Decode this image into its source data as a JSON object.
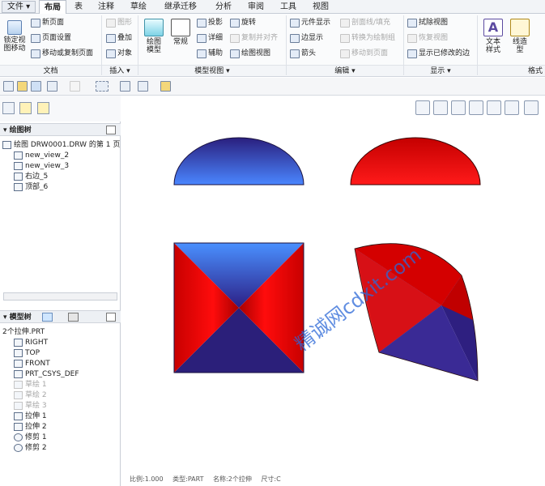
{
  "menu": {
    "file": "文件 ▾",
    "tabs": [
      "布局",
      "表",
      "注释",
      "草绘",
      "继承迁移",
      "分析",
      "审阅",
      "工具",
      "视图"
    ]
  },
  "ribbon": {
    "doc": {
      "lock_view": "锁定视\n图移动",
      "new_page": "新页面",
      "page_setup": "页面设置",
      "move_copy_page": "移动或复制页面",
      "label": "文档"
    },
    "insert": {
      "graphic": "图形",
      "overlay": "叠加",
      "object": "对象",
      "label": "插入 ▾"
    },
    "model_views": {
      "drawing_model": "绘图\n模型",
      "general": "常规",
      "projection": "投影",
      "detail": "详细",
      "auxiliary": "辅助",
      "rotate": "旋转",
      "copy_align": "复制并对齐",
      "drawing_view": "绘图视图",
      "label": "模型视图 ▾"
    },
    "edit": {
      "element_display": "元件显示",
      "edge_display": "边显示",
      "arrow": "箭头",
      "section_fill": "剖面线/填充",
      "convert_draw_group": "转换为绘制组",
      "move_to_page": "移动到页面",
      "label": "编辑 ▾"
    },
    "display": {
      "erase_view": "拭除视图",
      "restore_view": "恢复视图",
      "show_modified_edges": "显示已修改的边",
      "label": "显示 ▾"
    },
    "format": {
      "text_style": "文本\n样式",
      "line_style": "线造\n型",
      "label": "格式"
    }
  },
  "drawing_tree": {
    "title": "绘图树",
    "items": [
      "绘图 DRW0001.DRW 的第 1 页",
      "new_view_2",
      "new_view_3",
      "右边_5",
      "顶部_6"
    ]
  },
  "model_tree": {
    "title": "模型树",
    "root": "2个拉伸.PRT",
    "items": [
      {
        "label": "RIGHT",
        "dim": false
      },
      {
        "label": "TOP",
        "dim": false
      },
      {
        "label": "FRONT",
        "dim": false
      },
      {
        "label": "PRT_CSYS_DEF",
        "dim": false
      },
      {
        "label": "草绘 1",
        "dim": true
      },
      {
        "label": "草绘 2",
        "dim": true
      },
      {
        "label": "草绘 3",
        "dim": true
      },
      {
        "label": "拉伸 1",
        "dim": false
      },
      {
        "label": "拉伸 2",
        "dim": false
      },
      {
        "label": "修剪 1",
        "dim": false
      },
      {
        "label": "修剪 2",
        "dim": false
      }
    ]
  },
  "status": {
    "scale": "比例:1.000",
    "type": "类型:PART",
    "name": "名称:2个拉伸",
    "size": "尺寸:C"
  },
  "watermark": "精诚网cdxit.com",
  "colors": {
    "blue_shade": "#2b1f8a",
    "blue_light": "#3f7de8",
    "red_shade": "#d10d0d",
    "red_dark": "#7a0000"
  }
}
